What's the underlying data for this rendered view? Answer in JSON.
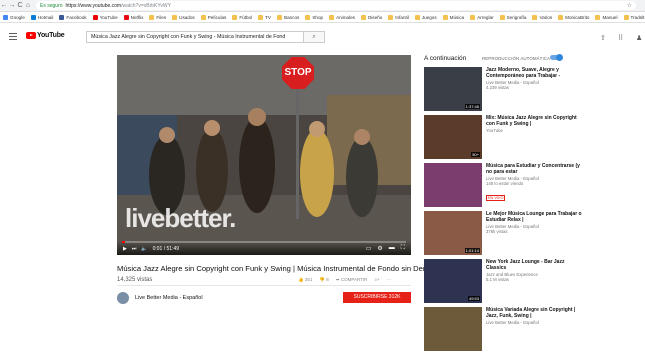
{
  "browser": {
    "secure_label": "Es seguro",
    "url_main": "https://www.youtube.com",
    "url_rest": "/watch?v=xBrbKYvWY",
    "bookmarks": [
      "Google",
      "Hotmail",
      "Facebook",
      "YouTube",
      "Netflix",
      "Files",
      "Usados",
      "Películas",
      "Fútbol",
      "TV",
      "Bancos",
      "Shop",
      "Animales",
      "Diseño",
      "Infantil",
      "Juegos",
      "Música",
      "Arreglar",
      "Serigrafía",
      "Varios",
      "MonicaBrito",
      "Manuel",
      "Tradslt brasz"
    ]
  },
  "header": {
    "logo_text": "YouTube",
    "search_value": "Música Jazz Alegre sin Copyright con Funk y Swing - Música Instrumental de Fond"
  },
  "video": {
    "stop_text": "STOP",
    "watermark": "livebetter.",
    "time": "0:01 / 51:49",
    "progress": 0.01,
    "title": "Música Jazz Alegre sin Copyright con Funk y Swing | Música Instrumental de Fondo sin Derechos Muzak",
    "views": "14,325 vistas",
    "likes": "351",
    "dislikes": "8",
    "share": "COMPARTIR",
    "channel": "Live Better Media - Español",
    "subscribe": "SUSCRIBIRSE 312K"
  },
  "sidebar": {
    "up_next": "A continuación",
    "autoplay": "REPRODUCCIÓN AUTOMÁTICA",
    "items": [
      {
        "title": "Jazz Moderno, Suave, Alegre y Contemporáneo para Trabajar -",
        "channel": "Live Better Media - Español",
        "views": "4.239 vistas",
        "duration": "1:37:48",
        "color": "#3a3f47"
      },
      {
        "title": "Mix: Música Jazz Alegre sin Copyright con Funk y Swing |",
        "channel": "YouTube",
        "views": "",
        "duration": "50+",
        "color": "#5b3b2a"
      },
      {
        "title": "Música para Estudiar y Concentrarse (y no para estar",
        "channel": "Live Better Media - Español",
        "views": "148 lo están viendo",
        "duration": "",
        "live": "EN VIVO",
        "color": "#7a3d6e"
      },
      {
        "title": "Le Mejor Música Lounge para Trabajar o Estudiar Relax |",
        "channel": "Live Better Media - Español",
        "views": "376k vistas",
        "duration": "1:01:14",
        "color": "#8a5a46"
      },
      {
        "title": "New York Jazz Lounge - Bar Jazz Classics",
        "channel": "Jazz and Blues Experience",
        "views": "5.1 M vistas",
        "duration": "49:53",
        "color": "#2e3352"
      },
      {
        "title": "Música Variada Alegre sin Copyright | Jazz, Funk, Swing |",
        "channel": "Live Better Media - Español",
        "views": "",
        "duration": "",
        "color": "#6d5a3a"
      }
    ]
  }
}
